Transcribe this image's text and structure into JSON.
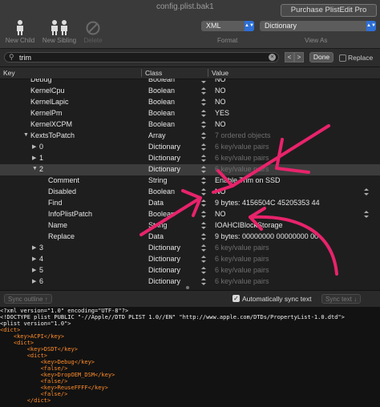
{
  "window": {
    "title": "config.plist.bak1"
  },
  "toolbar": {
    "new_child": "New Child",
    "new_sibling": "New Sibling",
    "delete": "Delete",
    "purchase": "Purchase PlistEdit Pro",
    "format_value": "XML",
    "format_label": "Format",
    "view_value": "Dictionary",
    "view_label": "View As"
  },
  "search": {
    "query": "trim",
    "done": "Done",
    "replace": "Replace",
    "prev": "<",
    "next": ">"
  },
  "columns": {
    "key": "Key",
    "class": "Class",
    "value": "Value"
  },
  "rows": [
    {
      "key": "Debug",
      "class": "Boolean",
      "value": "NO",
      "dim": false
    },
    {
      "key": "KernelCpu",
      "class": "Boolean",
      "value": "NO",
      "dim": false
    },
    {
      "key": "KernelLapic",
      "class": "Boolean",
      "value": "NO",
      "dim": false
    },
    {
      "key": "KernelPm",
      "class": "Boolean",
      "value": "YES",
      "dim": false
    },
    {
      "key": "KernelXCPM",
      "class": "Boolean",
      "value": "NO",
      "dim": false
    },
    {
      "key": "KextsToPatch",
      "class": "Array",
      "value": "7 ordered objects",
      "dim": true
    },
    {
      "key": "0",
      "class": "Dictionary",
      "value": "6 key/value pairs",
      "dim": true
    },
    {
      "key": "1",
      "class": "Dictionary",
      "value": "6 key/value pairs",
      "dim": true
    },
    {
      "key": "2",
      "class": "Dictionary",
      "value": "6 key/value pairs",
      "dim": true
    },
    {
      "key": "Comment",
      "class": "String",
      "value": "Enable Trim on SSD",
      "dim": false
    },
    {
      "key": "Disabled",
      "class": "Boolean",
      "value": "NO",
      "dim": false
    },
    {
      "key": "Find",
      "class": "Data",
      "value": "9 bytes: 4156504C 45205353 44",
      "dim": false
    },
    {
      "key": "InfoPlistPatch",
      "class": "Boolean",
      "value": "NO",
      "dim": false
    },
    {
      "key": "Name",
      "class": "String",
      "value": "IOAHCIBlockStorage",
      "dim": false
    },
    {
      "key": "Replace",
      "class": "Data",
      "value": "9 bytes: 00000000 00000000 00",
      "dim": false
    },
    {
      "key": "3",
      "class": "Dictionary",
      "value": "6 key/value pairs",
      "dim": true
    },
    {
      "key": "4",
      "class": "Dictionary",
      "value": "6 key/value pairs",
      "dim": true
    },
    {
      "key": "5",
      "class": "Dictionary",
      "value": "6 key/value pairs",
      "dim": true
    },
    {
      "key": "6",
      "class": "Dictionary",
      "value": "6 key/value pairs",
      "dim": true
    }
  ],
  "sync": {
    "outline": "Sync outline ↑",
    "auto": "Automatically sync text",
    "text": "Sync text ↓"
  },
  "xml_lines": [
    "<?xml version=\"1.0\" encoding=\"UTF-8\"?>",
    "<!DOCTYPE plist PUBLIC \"-//Apple//DTD PLIST 1.0//EN\" \"http://www.apple.com/DTDs/PropertyList-1.0.dtd\">",
    "<plist version=\"1.0\">",
    "<dict>",
    "    <key>ACPI</key>",
    "    <dict>",
    "        <key>DSDT</key>",
    "        <dict>",
    "            <key>Debug</key>",
    "            <false/>",
    "            <key>DropOEM_DSM</key>",
    "            <false/>",
    "            <key>ReuseFFFF</key>",
    "            <false/>",
    "        </dict>"
  ],
  "colors": {
    "annotation": "#e8236b",
    "selection": "#3c3c3c",
    "xml_tag": "#ff8c2a"
  }
}
